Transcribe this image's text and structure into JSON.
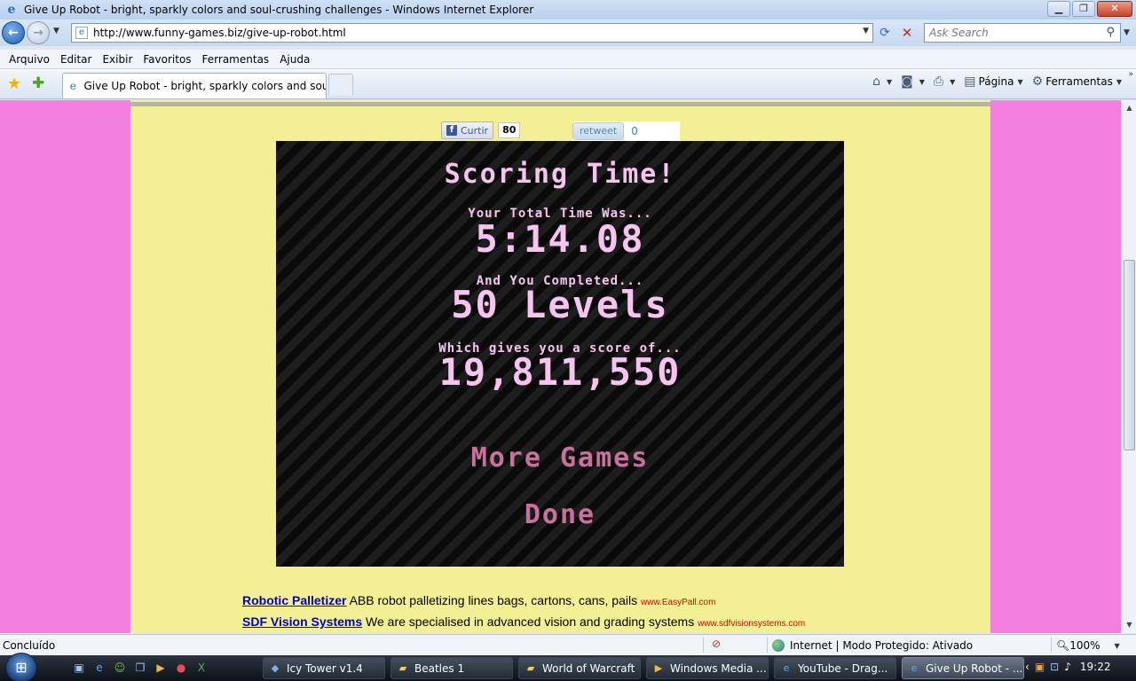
{
  "window": {
    "title": "Give Up Robot - bright, sparkly colors and soul-crushing challenges - Windows Internet Explorer"
  },
  "address": {
    "url": "http://www.funny-games.biz/give-up-robot.html"
  },
  "search": {
    "placeholder": "Ask Search"
  },
  "menu": [
    "Arquivo",
    "Editar",
    "Exibir",
    "Favoritos",
    "Ferramentas",
    "Ajuda"
  ],
  "tab": {
    "label": "Give Up Robot - bright, sparkly colors and soul-cr..."
  },
  "commandbar": {
    "page_label": "Página",
    "tools_label": "Ferramentas"
  },
  "social": {
    "like_label": "Curtir",
    "like_count": "80",
    "retweet_label": "retweet",
    "retweet_count": "0"
  },
  "game": {
    "title": "Scoring Time!",
    "time_label": "Your Total Time Was...",
    "time_value": "5:14.08",
    "levels_label": "And You Completed...",
    "levels_value": "50 Levels",
    "score_label": "Which gives you a score of...",
    "score_value": "19,811,550",
    "more_games": "More Games",
    "done": "Done"
  },
  "ads": [
    {
      "title": "Robotic Palletizer",
      "text": " ABB robot palletizing lines bags, cartons, cans, pails ",
      "url": "www.EasyPall.com"
    },
    {
      "title": "SDF Vision Systems",
      "text": " We are specialised in advanced vision and grading systems ",
      "url": "www.sdfvisionsystems.com"
    }
  ],
  "status": {
    "text": "Concluído",
    "zone": "Internet | Modo Protegido: Ativado",
    "zoom": "100%"
  },
  "taskbar": {
    "tasks": [
      "Icy Tower v1.4",
      "Beatles 1",
      "World of Warcraft",
      "Windows Media ...",
      "YouTube - Drag...",
      "Give Up Robot - ..."
    ],
    "clock": "19:22"
  }
}
